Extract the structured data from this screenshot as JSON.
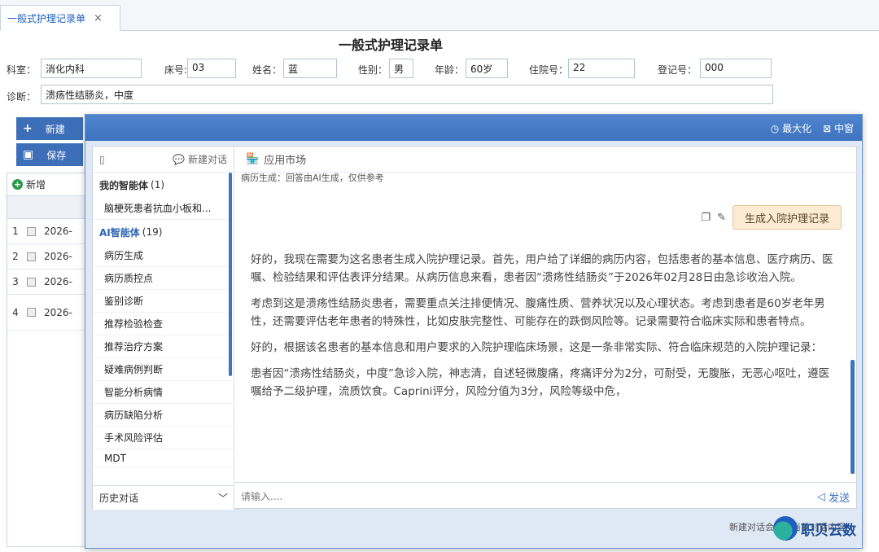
{
  "tab": {
    "label": "一般式护理记录单",
    "close": "×"
  },
  "form": {
    "title": "一般式护理记录单",
    "dept_label": "科室：",
    "dept_value": "消化内科",
    "bed_label": "床号:",
    "bed_value": "03",
    "name_label": "姓名：",
    "name_value": "蓝",
    "sex_label": "性别：",
    "sex_value": "男",
    "age_label": "年龄：",
    "age_value": "60岁",
    "inpatient_label": "住院号：",
    "inpatient_value": "22",
    "reg_label": "登记号：",
    "reg_value": "000",
    "diag_label": "诊断：",
    "diag_value": "溃疡性结肠炎，中度"
  },
  "toolbar": {
    "new_label": "新建",
    "save_label": "保存",
    "add_label": "新增"
  },
  "grid": {
    "rows": [
      {
        "no": "1",
        "date": "2026-"
      },
      {
        "no": "2",
        "date": "2026-"
      },
      {
        "no": "3",
        "date": "2026-"
      },
      {
        "no": "4",
        "date": "2026-"
      }
    ]
  },
  "dialog": {
    "maximize": "最大化",
    "minimize": "中窗",
    "sidebar": {
      "new_chat": "新建对话",
      "my_agents_label": "我的智能体",
      "my_agents_count": "(1)",
      "my_agents": [
        "脑梗死患者抗血小板和..."
      ],
      "ai_agents_label": "AI智能体",
      "ai_agents_count": "(19)",
      "ai_agents": [
        "病历生成",
        "病历质控点",
        "鉴别诊断",
        "推荐检验检查",
        "推荐治疗方案",
        "疑难病例判断",
        "智能分析病情",
        "病历缺陷分析",
        "手术风险评估",
        "MDT"
      ],
      "history": "历史对话"
    },
    "main": {
      "market": "应用市场",
      "notice": "病历生成：回答由AI生成，仅供参考",
      "gen_button": "生成入院护理记录",
      "paragraphs": [
        "好的，我现在需要为这名患者生成入院护理记录。首先，用户给了详细的病历内容，包括患者的基本信息、医疗病历、医嘱、检验结果和评估表评分结果。从病历信息来看，患者因“溃疡性结肠炎”于2026年02月28日由急诊收治入院。",
        "考虑到这是溃疡性结肠炎患者，需要重点关注排便情况、腹痛性质、营养状况以及心理状态。考虑到患者是60岁老年男性，还需要评估老年患者的特殊性，比如皮肤完整性、可能存在的跌倒风险等。记录需要符合临床实际和患者特点。",
        "好的，根据该名患者的基本信息和用户要求的入院护理临床场景，这是一条非常实际、符合临床规范的入院护理记录：",
        "患者因“溃疡性结肠炎，中度”急诊入院，神志清，自述轻微腹痛，疼痛评分为2分，可耐受，无腹胀，无恶心呕吐，遵医嘱给予二级护理，流质饮食。Caprini评分，风险分值为3分，风险等级中危，"
      ],
      "input_placeholder": "请输入....",
      "send": "发送"
    },
    "footer": "新建对话会清空当前对话内容"
  },
  "watermark": "职贝云数"
}
